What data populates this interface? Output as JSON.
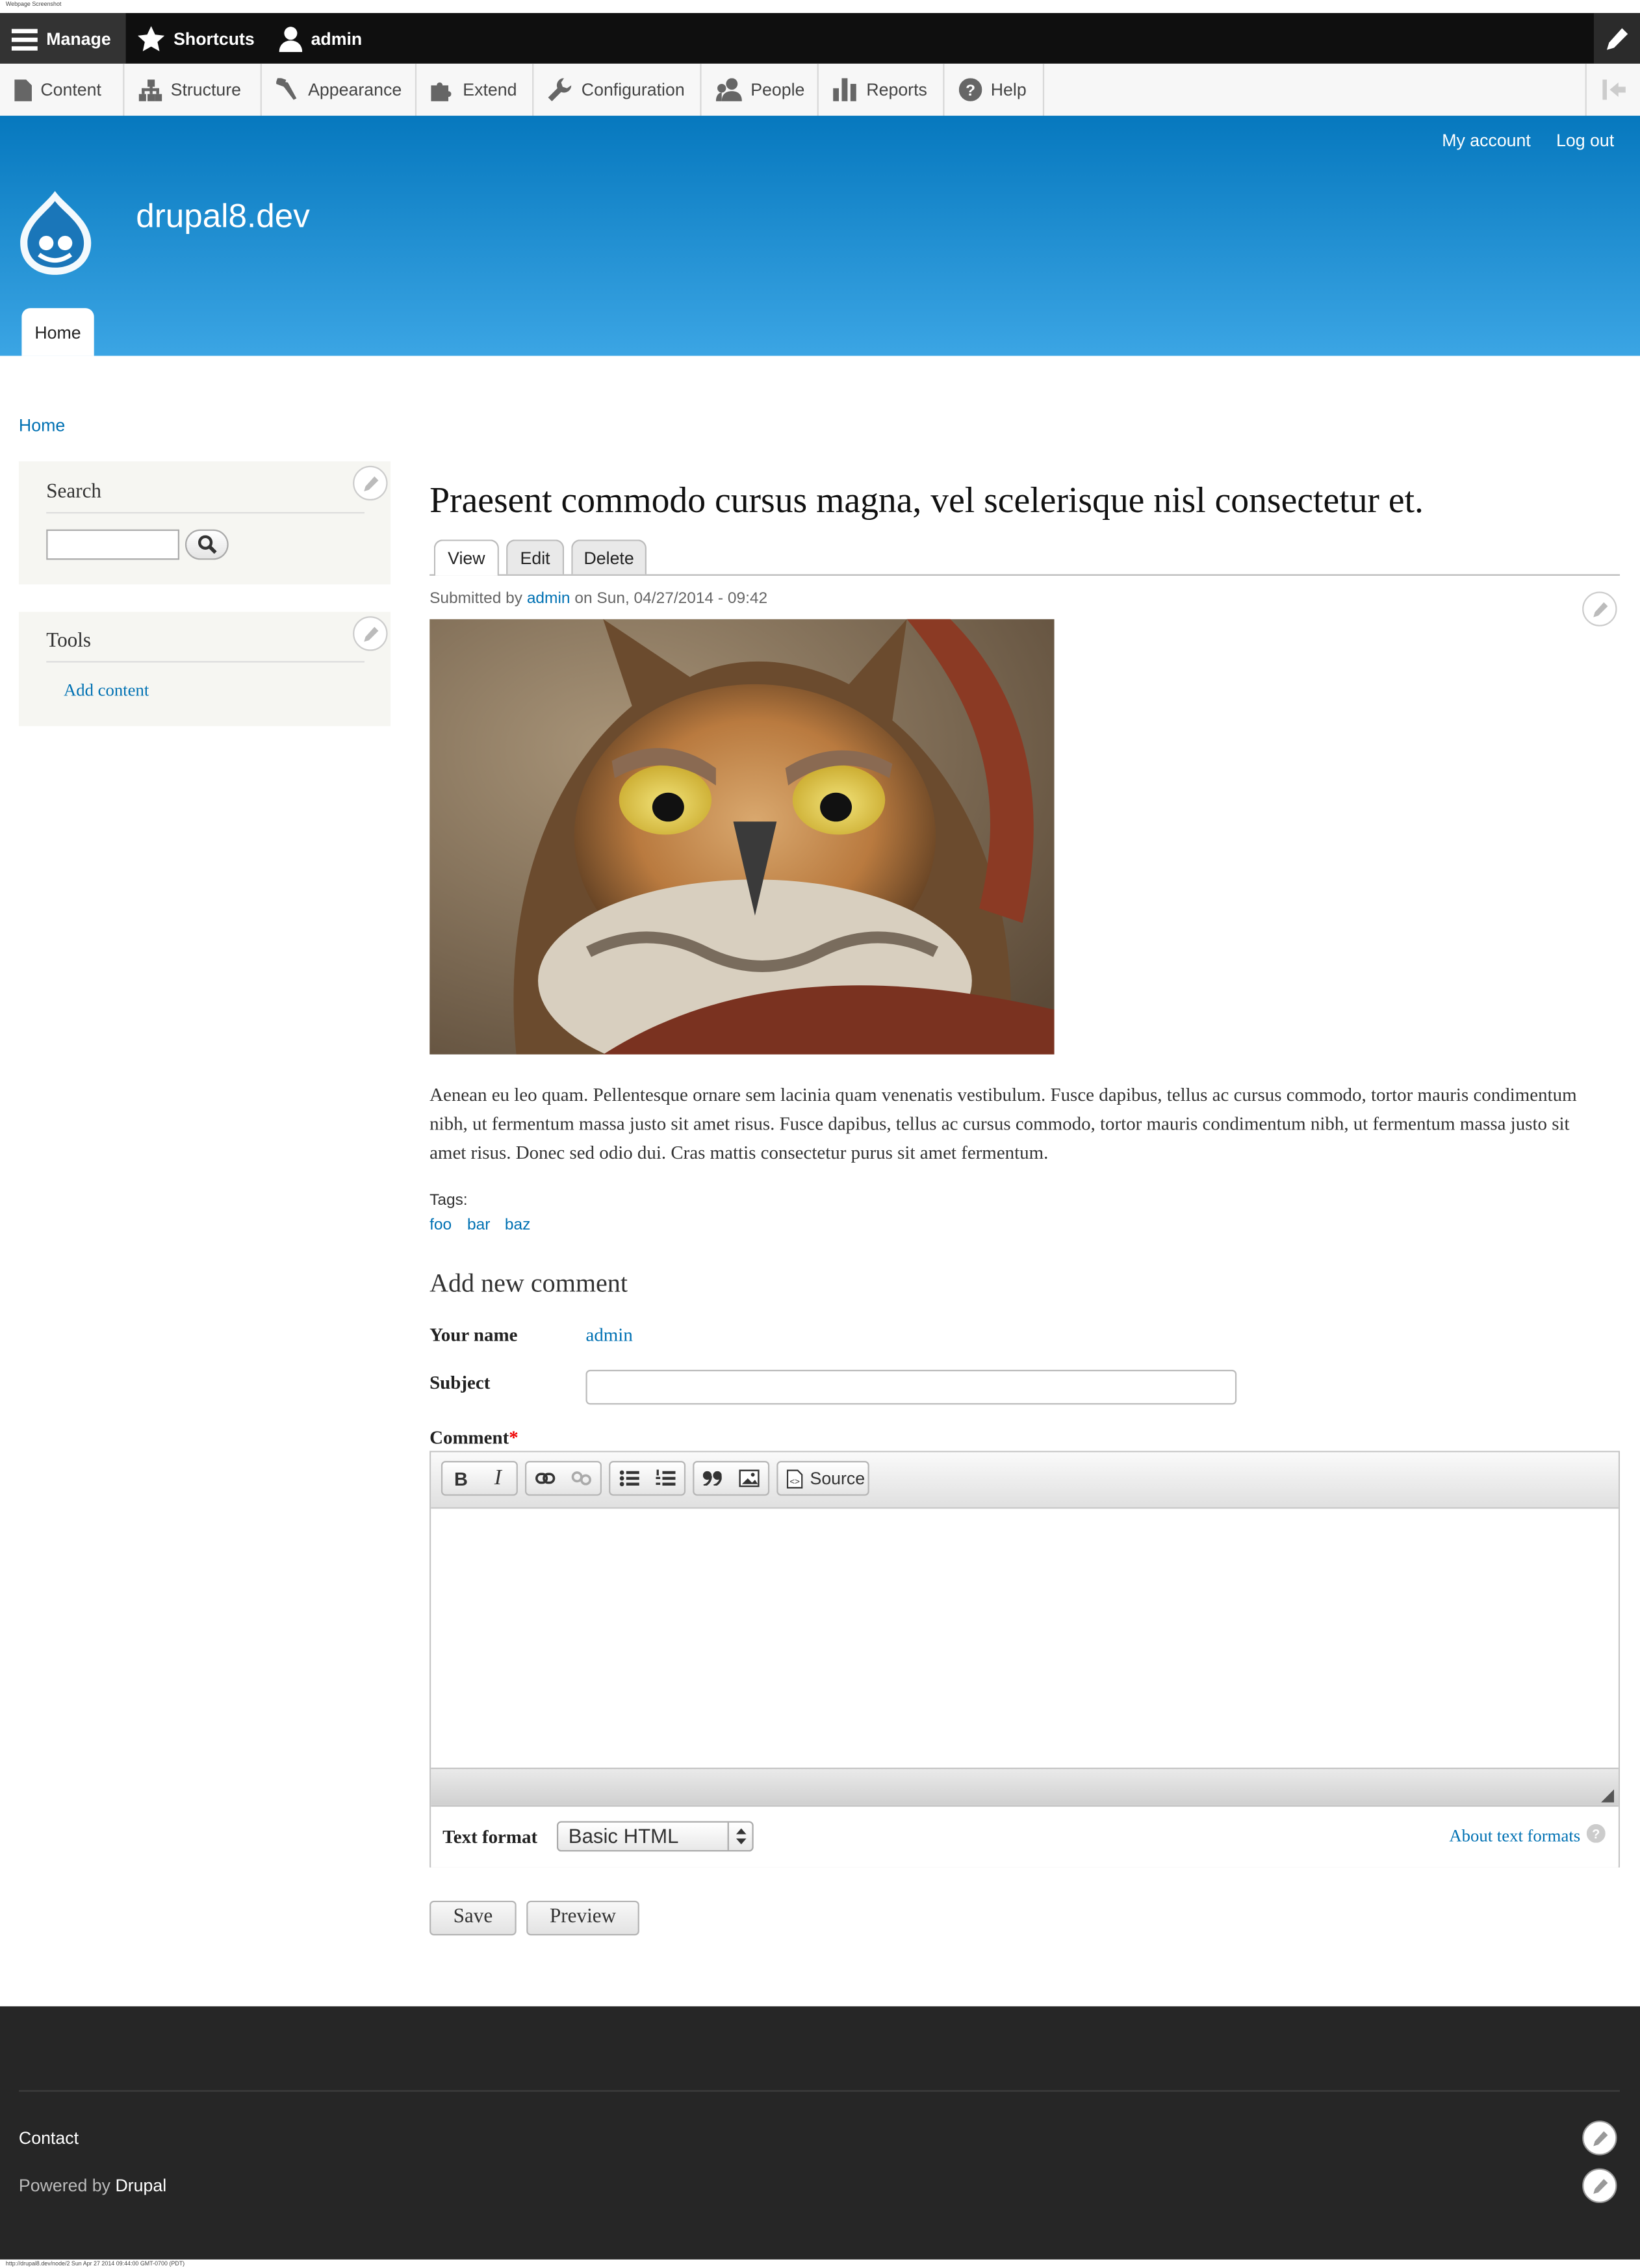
{
  "caption_top": "Webpage Screenshot",
  "caption_bottom": "http://drupal8.dev/node/2 Sun Apr 27 2014 09:44:00 GMT-0700 (PDT)",
  "toolbar": {
    "manage": "Manage",
    "shortcuts": "Shortcuts",
    "user": "admin"
  },
  "admin_menu": [
    {
      "label": "Content",
      "icon": "document-icon"
    },
    {
      "label": "Structure",
      "icon": "structure-icon"
    },
    {
      "label": "Appearance",
      "icon": "paintbrush-icon"
    },
    {
      "label": "Extend",
      "icon": "puzzle-icon"
    },
    {
      "label": "Configuration",
      "icon": "wrench-icon"
    },
    {
      "label": "People",
      "icon": "people-icon"
    },
    {
      "label": "Reports",
      "icon": "bar-chart-icon"
    },
    {
      "label": "Help",
      "icon": "help-icon"
    }
  ],
  "header": {
    "my_account": "My account",
    "log_out": "Log out",
    "site_name": "drupal8.dev",
    "home_tab": "Home"
  },
  "breadcrumb": "Home",
  "sidebar": {
    "search_title": "Search",
    "tools_title": "Tools",
    "add_content": "Add content"
  },
  "node": {
    "title": "Praesent commodo cursus magna, vel scelerisque nisl consectetur et.",
    "tabs": {
      "view": "View",
      "edit": "Edit",
      "delete": "Delete"
    },
    "submitted_prefix": "Submitted by",
    "author": "admin",
    "submitted_suffix": "on Sun, 04/27/2014 - 09:42",
    "body": "Aenean eu leo quam. Pellentesque ornare sem lacinia quam venenatis vestibulum. Fusce dapibus, tellus ac cursus commodo, tortor mauris condimentum nibh, ut fermentum massa justo sit amet risus. Fusce dapibus, tellus ac cursus commodo, tortor mauris condimentum nibh, ut fermentum massa justo sit amet risus. Donec sed odio dui. Cras mattis consectetur purus sit amet fermentum.",
    "tags_label": "Tags:",
    "tags": [
      "foo",
      "bar",
      "baz"
    ]
  },
  "comment_form": {
    "heading": "Add new comment",
    "your_name_label": "Your name",
    "your_name_value": "admin",
    "subject_label": "Subject",
    "subject_value": "",
    "comment_label": "Comment",
    "required_mark": "*",
    "editor_buttons": {
      "bold": "B",
      "italic": "I",
      "source": "Source"
    },
    "text_format_label": "Text format",
    "text_format_value": "Basic HTML",
    "about_formats": "About text formats",
    "save": "Save",
    "preview": "Preview"
  },
  "footer": {
    "contact": "Contact",
    "powered_prefix": "Powered by",
    "powered_link": "Drupal"
  },
  "colors": {
    "header_top": "#0678be",
    "header_bottom": "#3ba5e4",
    "link": "#0071b3",
    "footer": "#262626"
  }
}
